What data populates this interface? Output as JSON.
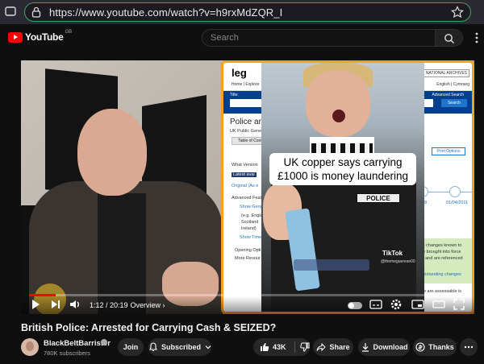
{
  "browser": {
    "url": "https://www.youtube.com/watch?v=h9rxMdZQR_I",
    "icons": [
      "tab-icon",
      "lock-icon",
      "star-icon"
    ]
  },
  "header": {
    "logo_text": "YouTube",
    "region": "GB",
    "search_placeholder": "Search"
  },
  "player": {
    "current_time": "1:12",
    "duration": "20:19",
    "time_display": "1:12 / 20:19",
    "chapter": "· Overview ›",
    "progress_fraction": 0.06,
    "overlay": {
      "caption": "UK copper says carrying £1000 is money laundering",
      "police_badge": "POLICE",
      "tiktok_label": "TikTok",
      "tiktok_handle": "@themeguerese00",
      "site_logo": "leg",
      "nav_left": "Home | Explore",
      "nav_right": "NATIONAL  ARCHIVES",
      "lang": "English | Cymraeg",
      "adv_search": "Advanced Search",
      "title_label": "Title:",
      "select_value": "the EU)",
      "search_btn": "Search",
      "heading": "Police an",
      "sub1": "UK Public Genera",
      "btn_contents": "Table of Cont",
      "print_options": "Print Options",
      "what_version": "What Version",
      "latest": "Latest avai",
      "original": "Original (As e",
      "adv_features": "Advanced Featu",
      "show_geo": "Show Geog",
      "geo_lines": [
        "(e.g. Engla",
        "Scotland",
        "Ireland)"
      ],
      "show_timeline": "Show Time",
      "opening": "Opening Opti",
      "more_resources": "More Resour",
      "date1": "2018",
      "date2": "01/04/2011",
      "green_lines": [
        "all changes known to",
        "be brought into force",
        "nt and are referenced"
      ],
      "outstanding": "outstanding changes",
      "bottom_text": "How are assessable is"
    }
  },
  "video": {
    "title": "British Police: Arrested for Carrying Cash & SEIZED?",
    "channel": "BlackBeltBarrister",
    "subscribers": "780K subscribers",
    "join_label": "Join",
    "subscribed_label": "Subscribed",
    "likes": "43K",
    "share_label": "Share",
    "download_label": "Download",
    "thanks_label": "Thanks"
  },
  "colors": {
    "accent_red": "#ff0000",
    "overlay_border": "#f4a21c",
    "url_border": "#3ba55c"
  }
}
